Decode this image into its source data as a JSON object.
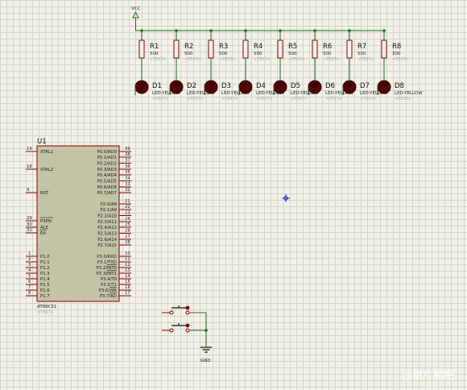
{
  "power": {
    "label": "VCC"
  },
  "ground": {
    "label": "GND"
  },
  "resistors": [
    {
      "ref": "R1",
      "value": "500",
      "text": "<TEXT>"
    },
    {
      "ref": "R2",
      "value": "500",
      "text": "<TEXT>"
    },
    {
      "ref": "R3",
      "value": "500",
      "text": "<TEXT>"
    },
    {
      "ref": "R4",
      "value": "500",
      "text": "<TEXT>"
    },
    {
      "ref": "R5",
      "value": "500",
      "text": "<TEXT>"
    },
    {
      "ref": "R6",
      "value": "500",
      "text": "<TEXT>"
    },
    {
      "ref": "R7",
      "value": "500",
      "text": "<TEXT>"
    },
    {
      "ref": "R8",
      "value": "300",
      "text": "<TEXT>"
    }
  ],
  "leds": [
    {
      "ref": "D1",
      "value": "LED-YELLOW",
      "text": "<TEXT>"
    },
    {
      "ref": "D2",
      "value": "LED-YELLOW",
      "text": "<TEXT>"
    },
    {
      "ref": "D3",
      "value": "LED-YELLOW",
      "text": "<TEXT>"
    },
    {
      "ref": "D4",
      "value": "LED-YELLOW",
      "text": "<TEXT>"
    },
    {
      "ref": "D5",
      "value": "LED-YELLOW",
      "text": "<TEXT>"
    },
    {
      "ref": "D6",
      "value": "LED-YELLOW",
      "text": "<TEXT>"
    },
    {
      "ref": "D7",
      "value": "LED-YELLOW",
      "text": "<TEXT>"
    },
    {
      "ref": "D8",
      "value": "LED-YELLOW",
      "text": "<TEXT>"
    }
  ],
  "mcu": {
    "ref": "U1",
    "part": "AT89C51",
    "text": "<TEXT>",
    "left_pins": [
      {
        "num": "19",
        "name": "XTAL1"
      },
      {
        "num": "18",
        "name": "XTAL2"
      },
      {
        "num": "9",
        "name": "RST"
      },
      {
        "num": "29",
        "name": "PSEN"
      },
      {
        "num": "30",
        "name": "ALE"
      },
      {
        "num": "31",
        "name": "EA"
      },
      {
        "num": "1",
        "name": "P1.0"
      },
      {
        "num": "2",
        "name": "P1.1"
      },
      {
        "num": "3",
        "name": "P1.2"
      },
      {
        "num": "4",
        "name": "P1.3"
      },
      {
        "num": "5",
        "name": "P1.4"
      },
      {
        "num": "6",
        "name": "P1.5"
      },
      {
        "num": "7",
        "name": "P1.6"
      },
      {
        "num": "8",
        "name": "P1.7"
      }
    ],
    "right_pins": [
      {
        "num": "39",
        "name": "P0.0/AD0"
      },
      {
        "num": "38",
        "name": "P0.1/AD1"
      },
      {
        "num": "37",
        "name": "P0.2/AD2"
      },
      {
        "num": "36",
        "name": "P0.3/AD3"
      },
      {
        "num": "35",
        "name": "P0.4/AD4"
      },
      {
        "num": "34",
        "name": "P0.5/AD5"
      },
      {
        "num": "33",
        "name": "P0.6/AD6"
      },
      {
        "num": "32",
        "name": "P0.7/AD7"
      },
      {
        "num": "21",
        "name": "P2.0/A8"
      },
      {
        "num": "22",
        "name": "P2.1/A9"
      },
      {
        "num": "23",
        "name": "P2.2/A10"
      },
      {
        "num": "24",
        "name": "P2.3/A11"
      },
      {
        "num": "25",
        "name": "P2.4/A12"
      },
      {
        "num": "26",
        "name": "P2.5/A13"
      },
      {
        "num": "27",
        "name": "P2.6/A14"
      },
      {
        "num": "28",
        "name": "P2.7/A15"
      },
      {
        "num": "10",
        "name": "P3.0/RXD"
      },
      {
        "num": "11",
        "name": "P3.1/TXD"
      },
      {
        "num": "12",
        "name": "P3.2/INT0"
      },
      {
        "num": "13",
        "name": "P3.3/INT1"
      },
      {
        "num": "14",
        "name": "P3.4/T0"
      },
      {
        "num": "15",
        "name": "P3.5/T1"
      },
      {
        "num": "16",
        "name": "P3.6/WR"
      },
      {
        "num": "17",
        "name": "P3.7/RD"
      }
    ]
  },
  "watermark": {
    "text": "@单片机吧"
  }
}
